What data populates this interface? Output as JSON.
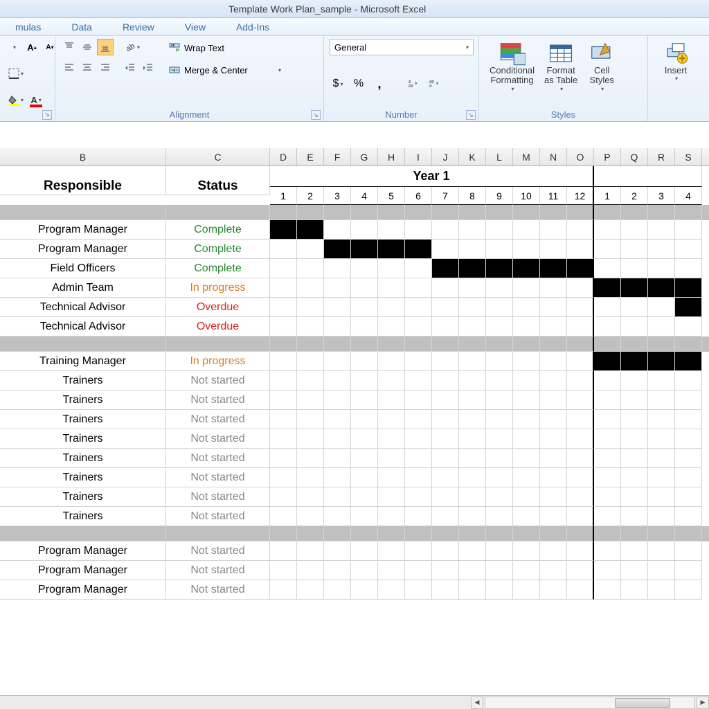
{
  "window": {
    "title": "Template Work Plan_sample  -  Microsoft Excel"
  },
  "ribbon_tabs": [
    "mulas",
    "Data",
    "Review",
    "View",
    "Add-Ins"
  ],
  "ribbon": {
    "number_format": "General",
    "groups": {
      "alignment": {
        "label": "Alignment",
        "wrap": "Wrap Text",
        "merge": "Merge & Center"
      },
      "number": {
        "label": "Number"
      },
      "styles": {
        "label": "Styles",
        "conditional": "Conditional\nFormatting",
        "format_table": "Format\nas Table",
        "cell_styles": "Cell\nStyles"
      },
      "cells": {
        "insert": "Insert"
      }
    }
  },
  "columns": {
    "letters": [
      "B",
      "C",
      "D",
      "E",
      "F",
      "G",
      "H",
      "I",
      "J",
      "K",
      "L",
      "M",
      "N",
      "O",
      "P",
      "Q",
      "R",
      "S"
    ],
    "widths": [
      "w-b",
      "w-c",
      "w-m",
      "w-m",
      "w-m",
      "w-m",
      "w-m",
      "w-m",
      "w-m",
      "w-m",
      "w-m",
      "w-m",
      "w-m",
      "w-m",
      "w-m",
      "w-m",
      "w-m",
      "w-m"
    ]
  },
  "sheet_headers": {
    "responsible": "Responsible",
    "status": "Status",
    "year1": "Year 1",
    "months_year1": [
      "1",
      "2",
      "3",
      "4",
      "5",
      "6",
      "7",
      "8",
      "9",
      "10",
      "11",
      "12"
    ],
    "months_year2": [
      "1",
      "2",
      "3",
      "4"
    ]
  },
  "status_labels": {
    "complete": "Complete",
    "in_progress": "In progress",
    "overdue": "Overdue",
    "not_started": "Not started"
  },
  "rows": [
    {
      "type": "sep"
    },
    {
      "responsible": "Program Manager",
      "status": "complete",
      "bars": [
        0,
        1
      ]
    },
    {
      "responsible": "Program Manager",
      "status": "complete",
      "bars": [
        2,
        3,
        4,
        5
      ]
    },
    {
      "responsible": "Field Officers",
      "status": "complete",
      "bars": [
        6,
        7,
        8,
        9,
        10,
        11
      ]
    },
    {
      "responsible": "Admin Team",
      "status": "in_progress",
      "bars": [
        12,
        13,
        14,
        15
      ]
    },
    {
      "responsible": "Technical Advisor",
      "status": "overdue",
      "bars": [
        15
      ]
    },
    {
      "responsible": "Technical Advisor",
      "status": "overdue",
      "bars": []
    },
    {
      "type": "sep"
    },
    {
      "responsible": "Training Manager",
      "status": "in_progress",
      "bars": [
        12,
        13,
        14,
        15
      ]
    },
    {
      "responsible": "Trainers",
      "status": "not_started",
      "bars": []
    },
    {
      "responsible": "Trainers",
      "status": "not_started",
      "bars": []
    },
    {
      "responsible": "Trainers",
      "status": "not_started",
      "bars": []
    },
    {
      "responsible": "Trainers",
      "status": "not_started",
      "bars": []
    },
    {
      "responsible": "Trainers",
      "status": "not_started",
      "bars": []
    },
    {
      "responsible": "Trainers",
      "status": "not_started",
      "bars": []
    },
    {
      "responsible": "Trainers",
      "status": "not_started",
      "bars": []
    },
    {
      "responsible": "Trainers",
      "status": "not_started",
      "bars": []
    },
    {
      "type": "sep"
    },
    {
      "responsible": "Program Manager",
      "status": "not_started",
      "bars": []
    },
    {
      "responsible": "Program Manager",
      "status": "not_started",
      "bars": []
    },
    {
      "responsible": "Program Manager",
      "status": "not_started",
      "bars": []
    }
  ],
  "status_class_map": {
    "complete": "status-complete",
    "in_progress": "status-inprogress",
    "overdue": "status-overdue",
    "not_started": "status-notstarted"
  }
}
